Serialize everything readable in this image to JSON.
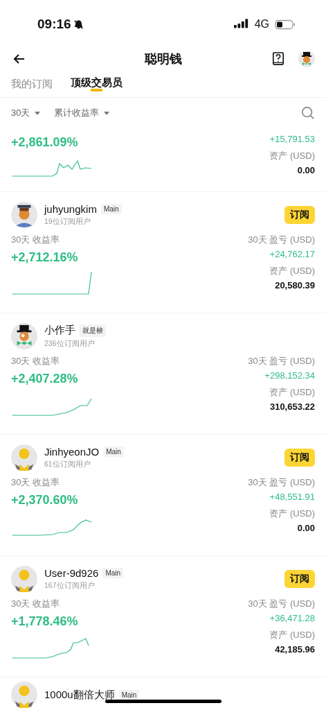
{
  "status_bar": {
    "time": "09:16",
    "network": "4G"
  },
  "header": {
    "title": "聪明钱"
  },
  "tabs": [
    {
      "label": "我的订阅",
      "selected": false
    },
    {
      "label": "顶级交易员",
      "selected": true
    }
  ],
  "filters": [
    {
      "label": "30天"
    },
    {
      "label": "累计收益率"
    }
  ],
  "cards": [
    {
      "kind": "partial",
      "return_value": "+2,861.09%",
      "pnl_value": "+15,791.53",
      "assets_label": "资产 (USD)",
      "assets_value": "0.00"
    },
    {
      "kind": "full",
      "avatar": {
        "kind": "graduate"
      },
      "name": "juhyungkim",
      "tag": "Main",
      "subscribers": "19位订阅用户",
      "subscribe": "订阅",
      "return_label": "30天 收益率",
      "return_value": "+2,712.16%",
      "pnl_label": "30天 盈亏 (USD)",
      "pnl_value": "+24,762.17",
      "assets_label": "资产 (USD)",
      "assets_value": "20,580.39"
    },
    {
      "kind": "full",
      "avatar": {
        "kind": "tophat"
      },
      "name": "小作手",
      "tag": "就是梭",
      "subscribers": "236位订阅用户",
      "return_label": "30天 收益率",
      "return_value": "+2,407.28%",
      "pnl_label": "30天 盈亏 (USD)",
      "pnl_value": "+298,152.34",
      "assets_label": "资产 (USD)",
      "assets_value": "310,653.22"
    },
    {
      "kind": "full",
      "avatar": {
        "kind": "default"
      },
      "name": "JinhyeonJO",
      "tag": "Main",
      "subscribers": "61位订阅用户",
      "subscribe": "订阅",
      "return_label": "30天 收益率",
      "return_value": "+2,370.60%",
      "pnl_label": "30天 盈亏 (USD)",
      "pnl_value": "+48,551.91",
      "assets_label": "资产 (USD)",
      "assets_value": "0.00"
    },
    {
      "kind": "full",
      "avatar": {
        "kind": "default"
      },
      "name": "User-9d926",
      "tag": "Main",
      "subscribers": "167位订阅用户",
      "subscribe": "订阅",
      "return_label": "30天 收益率",
      "return_value": "+1,778.46%",
      "pnl_label": "30天 盈亏 (USD)",
      "pnl_value": "+36,471.28",
      "assets_label": "资产 (USD)",
      "assets_value": "42,185.96"
    },
    {
      "kind": "cut",
      "avatar": {
        "kind": "default"
      },
      "name": "1000u翻倍大师",
      "tag": "Main"
    }
  ]
}
